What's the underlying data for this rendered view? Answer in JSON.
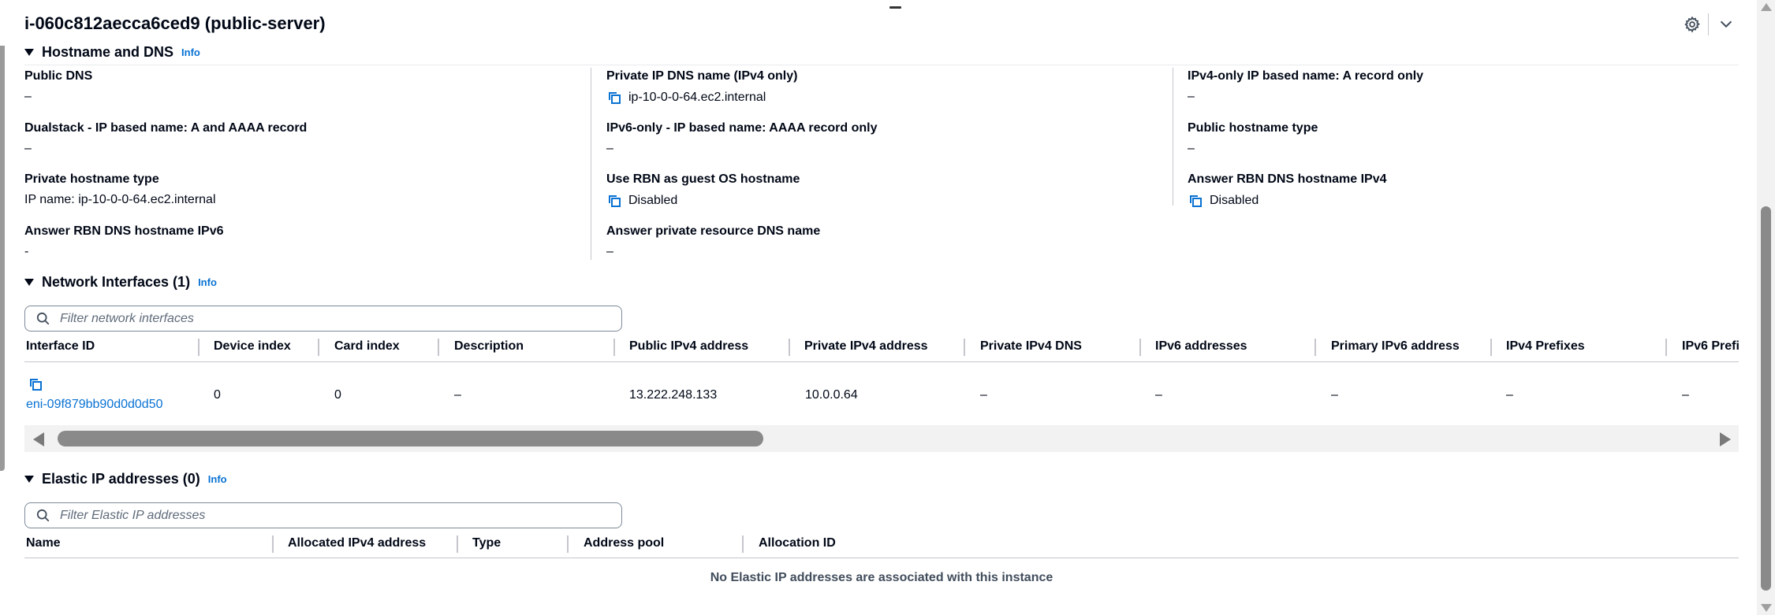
{
  "header": {
    "title": "i-060c812aecca6ced9 (public-server)",
    "settings_icon": "gear-icon",
    "collapse_icon": "chevron-down-icon"
  },
  "hostname_section": {
    "title": "Hostname and DNS",
    "info": "Info",
    "fields": [
      {
        "label": "Public DNS",
        "value": "–",
        "copyable": false
      },
      {
        "label": "Private IP DNS name (IPv4 only)",
        "value": "ip-10-0-0-64.ec2.internal",
        "copyable": true
      },
      {
        "label": "IPv4-only IP based name: A record only",
        "value": "–",
        "copyable": false
      },
      {
        "label": "Dualstack - IP based name: A and AAAA record",
        "value": "–",
        "copyable": false
      },
      {
        "label": "IPv6-only - IP based name: AAAA record only",
        "value": "–",
        "copyable": false
      },
      {
        "label": "Public hostname type",
        "value": "–",
        "copyable": false
      },
      {
        "label": "Private hostname type",
        "value": "IP name: ip-10-0-0-64.ec2.internal",
        "copyable": false
      },
      {
        "label": "Use RBN as guest OS hostname",
        "value": "Disabled",
        "copyable": true
      },
      {
        "label": "Answer RBN DNS hostname IPv4",
        "value": "Disabled",
        "copyable": true
      },
      {
        "label": "Answer RBN DNS hostname IPv6",
        "value": "-",
        "copyable": false
      },
      {
        "label": "Answer private resource DNS name",
        "value": "–",
        "copyable": false
      }
    ]
  },
  "network_interfaces": {
    "title": "Network Interfaces (1)",
    "info": "Info",
    "filter_placeholder": "Filter network interfaces",
    "columns": [
      "Interface ID",
      "Device index",
      "Card index",
      "Description",
      "Public IPv4 address",
      "Private IPv4 address",
      "Private IPv4 DNS",
      "IPv6 addresses",
      "Primary IPv6 address",
      "IPv4 Prefixes",
      "IPv6 Prefi"
    ],
    "rows": [
      [
        "eni-09f879bb90d0d0d50",
        "0",
        "0",
        "–",
        "13.222.248.133",
        "10.0.0.64",
        "–",
        "–",
        "–",
        "–",
        "–"
      ]
    ]
  },
  "elastic_ips": {
    "title": "Elastic IP addresses (0)",
    "info": "Info",
    "filter_placeholder": "Filter Elastic IP addresses",
    "columns": [
      "Name",
      "Allocated IPv4 address",
      "Type",
      "Address pool",
      "Allocation ID"
    ],
    "empty_message": "No Elastic IP addresses are associated with this instance"
  },
  "colors": {
    "link": "#0972d3",
    "text": "#000716",
    "divider": "#c6c6cd"
  }
}
